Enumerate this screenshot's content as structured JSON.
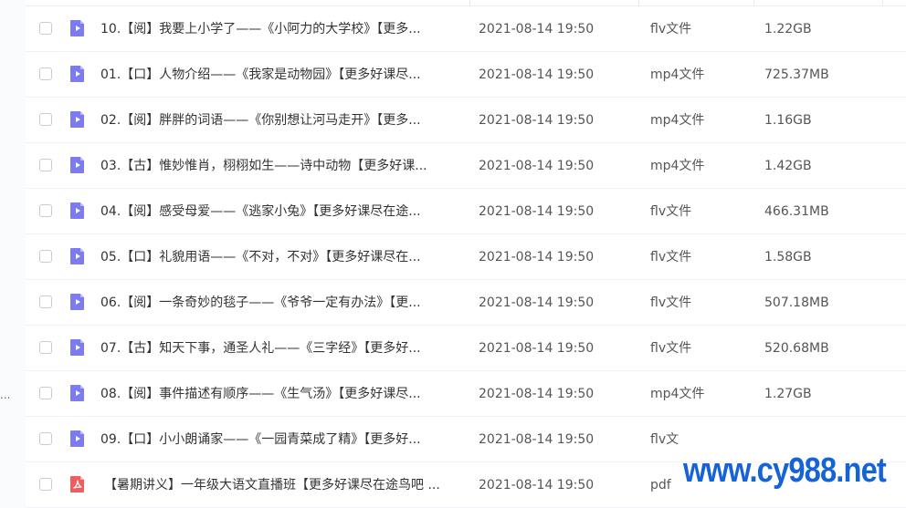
{
  "colors": {
    "video_icon": "#7c7cf0",
    "pdf_icon": "#f25c5c",
    "watermark": "#1663d6",
    "text": "#333333",
    "muted_text": "#555555"
  },
  "sidebar": {
    "ellipsis": "..."
  },
  "files": [
    {
      "name": "10.【阅】我要上小学了——《小阿力的大学校》【更多...",
      "date": "2021-08-14 19:50",
      "type": "flv文件",
      "size": "1.22GB",
      "icon": "video-file-icon"
    },
    {
      "name": "01.【口】人物介绍——《我家是动物园》【更多好课尽...",
      "date": "2021-08-14 19:50",
      "type": "mp4文件",
      "size": "725.37MB",
      "icon": "video-file-icon"
    },
    {
      "name": "02.【阅】胖胖的词语——《你别想让河马走开》【更多...",
      "date": "2021-08-14 19:50",
      "type": "mp4文件",
      "size": "1.16GB",
      "icon": "video-file-icon"
    },
    {
      "name": "03.【古】惟妙惟肖，栩栩如生——诗中动物【更多好课...",
      "date": "2021-08-14 19:50",
      "type": "mp4文件",
      "size": "1.42GB",
      "icon": "video-file-icon"
    },
    {
      "name": "04.【阅】感受母爱——《逃家小兔》【更多好课尽在途...",
      "date": "2021-08-14 19:50",
      "type": "flv文件",
      "size": "466.31MB",
      "icon": "video-file-icon"
    },
    {
      "name": "05.【口】礼貌用语——《不对，不对》【更多好课尽在...",
      "date": "2021-08-14 19:50",
      "type": "flv文件",
      "size": "1.58GB",
      "icon": "video-file-icon"
    },
    {
      "name": "06.【阅】一条奇妙的毯子——《爷爷一定有办法》【更...",
      "date": "2021-08-14 19:50",
      "type": "flv文件",
      "size": "507.18MB",
      "icon": "video-file-icon"
    },
    {
      "name": "07.【古】知天下事，通圣人礼——《三字经》【更多好...",
      "date": "2021-08-14 19:50",
      "type": "flv文件",
      "size": "520.68MB",
      "icon": "video-file-icon"
    },
    {
      "name": "08.【阅】事件描述有顺序——《生气汤》【更多好课尽...",
      "date": "2021-08-14 19:50",
      "type": "mp4文件",
      "size": "1.27GB",
      "icon": "video-file-icon"
    },
    {
      "name": "09.【口】小小朗诵家——《一园青菜成了精》【更多好...",
      "date": "2021-08-14 19:50",
      "type": "flv文",
      "size": "",
      "icon": "video-file-icon"
    },
    {
      "name": "【暑期讲义】一年级大语文直播班【更多好课尽在途鸟吧 ...",
      "date": "2021-08-14 19:50",
      "type": "pdf",
      "size": "",
      "icon": "pdf-file-icon"
    }
  ],
  "watermark": {
    "text": "www.cy988.net"
  }
}
